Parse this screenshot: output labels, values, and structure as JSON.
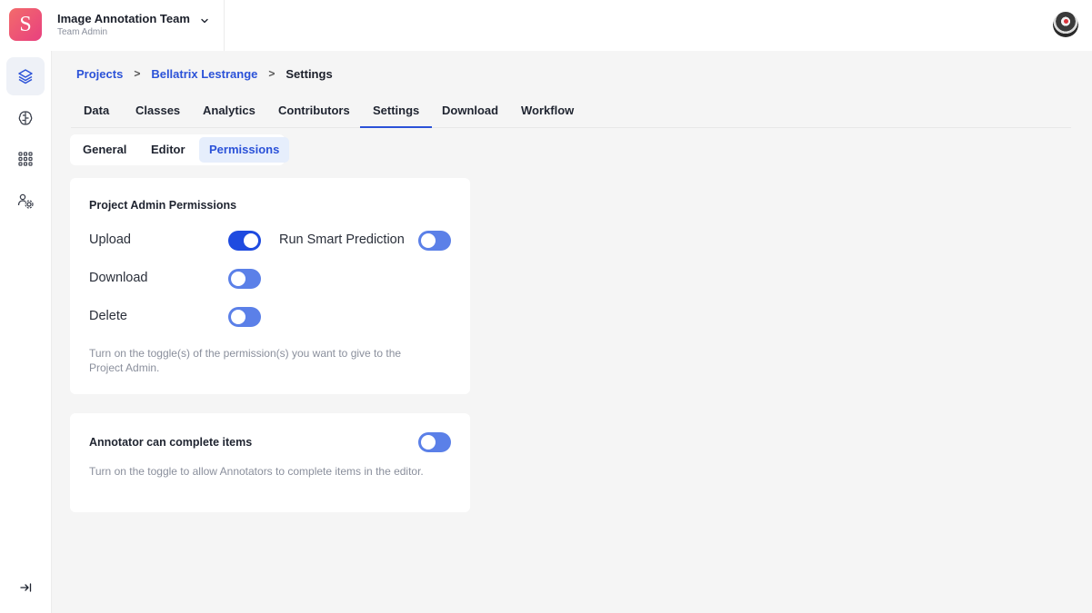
{
  "app": {
    "logo_letter": "S",
    "team_name": "Image Annotation Team",
    "team_role": "Team Admin"
  },
  "sidebar": {
    "items": [
      {
        "icon": "layers-icon",
        "active": true
      },
      {
        "icon": "brain-icon",
        "active": false
      },
      {
        "icon": "grid-dots-icon",
        "active": false
      },
      {
        "icon": "team-settings-icon",
        "active": false
      }
    ],
    "collapse_icon": "collapse-arrow-icon"
  },
  "breadcrumb": {
    "items": [
      "Projects",
      "Bellatrix Lestrange",
      "Settings"
    ],
    "separator": ">"
  },
  "tabs": [
    "Data",
    "Classes",
    "Analytics",
    "Contributors",
    "Settings",
    "Download",
    "Workflow"
  ],
  "active_tab": "Settings",
  "subtabs": [
    "General",
    "Editor",
    "Permissions"
  ],
  "active_subtab": "Permissions",
  "admin_permissions": {
    "title": "Project Admin Permissions",
    "items": [
      {
        "label": "Upload",
        "enabled": true
      },
      {
        "label": "Run Smart Prediction",
        "enabled": false
      },
      {
        "label": "Download",
        "enabled": false
      },
      {
        "label": "Delete",
        "enabled": false
      }
    ],
    "help": "Turn on the toggle(s) of the permission(s) you want to give to the Project Admin."
  },
  "annotator_setting": {
    "title": "Annotator can complete items",
    "enabled": false,
    "help": "Turn on the toggle to allow Annotators to complete items in the editor."
  },
  "colors": {
    "accent": "#2b52d8",
    "toggle_on": "#1f4be0",
    "toggle_off": "#5b80e8",
    "logo_gradient_start": "#f36b6b",
    "logo_gradient_end": "#e8407f"
  }
}
